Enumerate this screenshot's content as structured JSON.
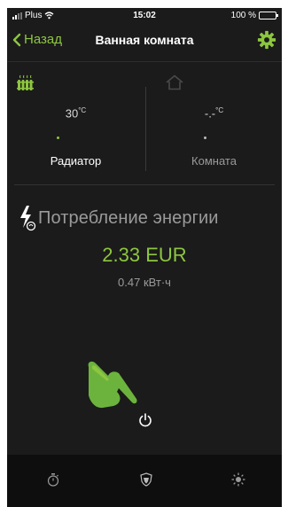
{
  "status_bar": {
    "carrier": "Plus",
    "time": "15:02",
    "battery_text": "100 %",
    "battery_level": 1.0
  },
  "nav": {
    "back_label": "Назад",
    "title": "Ванная комната",
    "settings_icon": "gear-icon"
  },
  "readings": {
    "radiator": {
      "icon": "radiator-icon",
      "value": "30",
      "unit": "°C",
      "label": "Радиатор",
      "dot_color": "#8dc63f",
      "label_color": "#ffffff",
      "icon_color": "#8dc63f"
    },
    "room": {
      "icon": "house-icon",
      "value": "-.-",
      "unit": "°C",
      "label": "Комната",
      "dot_color": "#bbbbbb",
      "label_color": "#9a9a9a",
      "icon_color": "#4a4a4a"
    }
  },
  "energy": {
    "icon": "lightning-icon",
    "title": "Потребление энергии",
    "cost": "2.33 EUR",
    "kwh": "0.47 кВт·ч"
  },
  "power": {
    "icon": "power-icon",
    "hint_icon": "pointing-hand-icon"
  },
  "tabbar": {
    "items": [
      {
        "icon": "timer-icon"
      },
      {
        "icon": "shield-icon"
      },
      {
        "icon": "sun-icon"
      }
    ]
  },
  "colors": {
    "accent": "#8dc63f",
    "background": "#1b1b1b",
    "tabbar": "#0e0e0e"
  }
}
